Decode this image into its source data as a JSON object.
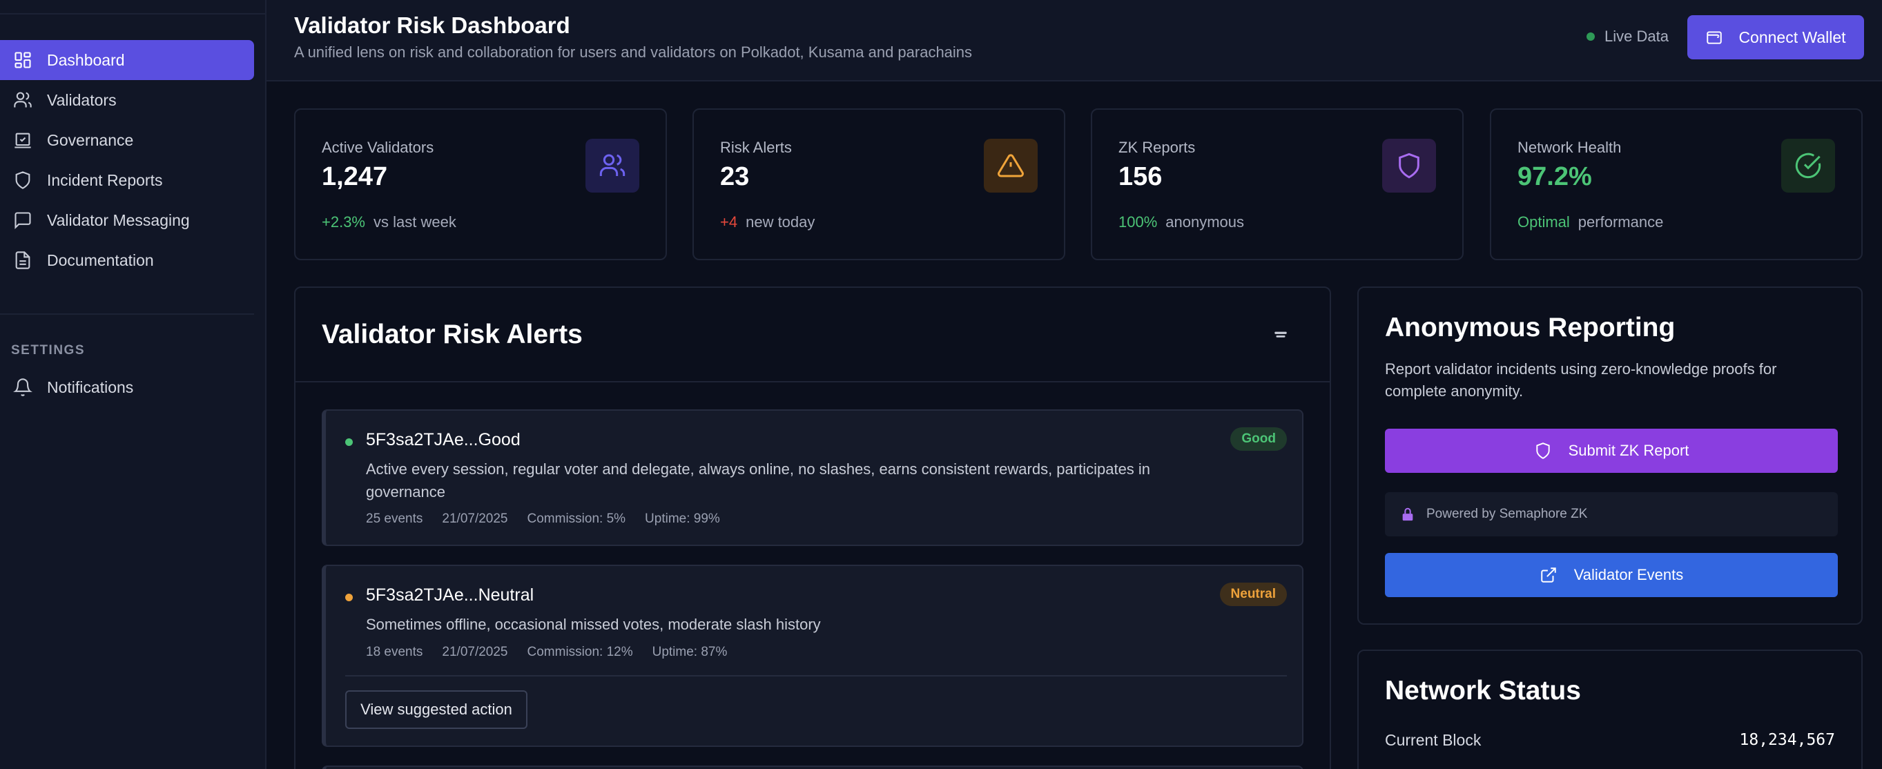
{
  "sidebar": {
    "nav": [
      {
        "label": "Dashboard",
        "icon": "dashboard-icon",
        "active": true
      },
      {
        "label": "Validators",
        "icon": "users-icon"
      },
      {
        "label": "Governance",
        "icon": "vote-icon"
      },
      {
        "label": "Incident Reports",
        "icon": "shield-icon"
      },
      {
        "label": "Validator Messaging",
        "icon": "message-icon"
      },
      {
        "label": "Documentation",
        "icon": "document-icon"
      }
    ],
    "settings_label": "SETTINGS",
    "settings": [
      {
        "label": "Notifications",
        "icon": "bell-icon"
      }
    ]
  },
  "header": {
    "title": "Validator Risk Dashboard",
    "subtitle": "A unified lens on risk and collaboration for users and validators on Polkadot, Kusama and parachains",
    "live_label": "Live Data",
    "connect_label": "Connect Wallet"
  },
  "stats": [
    {
      "label": "Active Validators",
      "value": "1,247",
      "delta": "+2.3%",
      "delta_color": "#4cc476",
      "foot": "vs last week",
      "icon": "users-icon",
      "icon_bg": "#1e1d4a",
      "icon_color": "#6d62f0"
    },
    {
      "label": "Risk Alerts",
      "value": "23",
      "delta": "+4",
      "delta_color": "#e5483b",
      "foot": "new today",
      "icon": "warning-icon",
      "icon_bg": "#3a2714",
      "icon_color": "#f0a43a"
    },
    {
      "label": "ZK Reports",
      "value": "156",
      "delta": "100%",
      "delta_color": "#4cc476",
      "foot": "anonymous",
      "icon": "shield-icon",
      "icon_bg": "#2a1c45",
      "icon_color": "#a86cf0"
    },
    {
      "label": "Network Health",
      "value": "97.2%",
      "value_color": "#4cc476",
      "delta": "Optimal",
      "delta_color": "#4cc476",
      "foot": "performance",
      "icon": "check-circle-icon",
      "icon_bg": "#16291f",
      "icon_color": "#4cc476"
    }
  ],
  "alerts": {
    "title": "Validator Risk Alerts",
    "items": [
      {
        "name": "5F3sa2TJAe...Good",
        "status": "Good",
        "dot_color": "#4cc476",
        "description": "Active every session, regular voter and delegate, always online, no slashes, earns consistent rewards, participates in governance",
        "events": "25 events",
        "date": "21/07/2025",
        "commission": "Commission: 5%",
        "uptime": "Uptime: 99%"
      },
      {
        "name": "5F3sa2TJAe...Neutral",
        "status": "Neutral",
        "dot_color": "#eea23b",
        "description": "Sometimes offline, occasional missed votes, moderate slash history",
        "events": "18 events",
        "date": "21/07/2025",
        "commission": "Commission: 12%",
        "uptime": "Uptime: 87%",
        "action_label": "View suggested action"
      }
    ]
  },
  "reporting": {
    "title": "Anonymous Reporting",
    "description": "Report validator incidents using zero-knowledge proofs for complete anonymity.",
    "submit_label": "Submit ZK Report",
    "powered_label": "Powered by Semaphore ZK",
    "events_label": "Validator Events"
  },
  "network_status": {
    "title": "Network Status",
    "current_block_label": "Current Block",
    "current_block_value": "18,234,567"
  }
}
